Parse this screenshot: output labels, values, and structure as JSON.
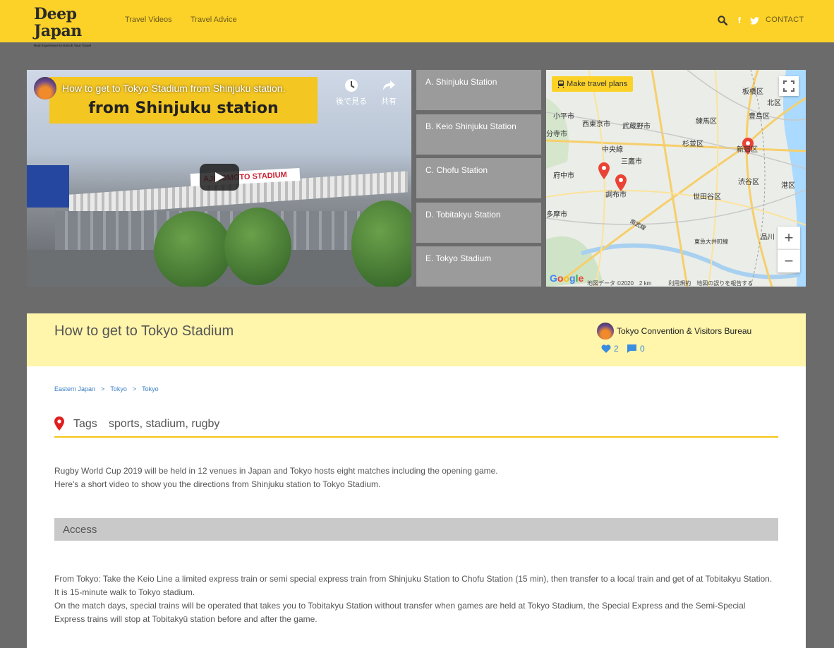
{
  "header": {
    "logo_text": "Deep Japan",
    "logo_tagline": "Real Experience to Enrich Your Travel",
    "nav": [
      "Travel Videos",
      "Travel Advice"
    ],
    "contact_label": "CONTACT",
    "icons": [
      "search-icon",
      "facebook-icon",
      "twitter-icon"
    ],
    "bg_color": "#fcd228"
  },
  "video": {
    "title": "How to get to Tokyo Stadium from Shinjuku station.",
    "banner_text": "from Shinjuku station",
    "sign_text": "AJINOMOTO STADIUM",
    "watch_later_label": "後で見る",
    "share_label": "共有"
  },
  "stations": [
    "A. Shinjuku Station",
    "B. Keio Shinjuku Station",
    "C. Chofu Station",
    "D. Tobitakyu Station",
    "E. Tokyo Stadium"
  ],
  "map": {
    "button_label": "Make travel plans",
    "labels": {
      "kodaira": "小平市",
      "nishitokyo": "西東京市",
      "musashino": "武蔵野市",
      "itabashi": "板橋区",
      "kita": "北区",
      "nerima": "練馬区",
      "toshima": "豊島区",
      "kokubunji": "分寺市",
      "chuo_line": "中央線",
      "suginami": "杉並区",
      "shinjuku": "新宿区",
      "mitaka": "三鷹市",
      "fuchu": "府中市",
      "chofu": "調布市",
      "shibuya": "渋谷区",
      "minato": "港区",
      "setagaya": "世田谷区",
      "tama": "多摩市",
      "nambu": "南武線",
      "toyoko": "東急大井町線",
      "shinagawa": "品川"
    },
    "footer": "地図データ ©2020　2 km　　　利用規約　地図の誤りを報告する",
    "google_letters": [
      "G",
      "o",
      "o",
      "g",
      "l",
      "e"
    ]
  },
  "article": {
    "title": "How to get to Tokyo Stadium",
    "author": "Tokyo Convention & Visitors Bureau",
    "likes": "2",
    "comments": "0",
    "breadcrumb": [
      "Eastern Japan",
      "Tokyo",
      "Tokyo"
    ],
    "breadcrumb_sep": ">",
    "tags_label": "Tags",
    "tags": "sports, stadium, rugby",
    "intro": [
      "Rugby World Cup 2019 will be held in 12 venues in Japan and Tokyo hosts eight matches including the opening game.",
      "Here's a short video to show you the directions from Shinjuku station to Tokyo Stadium."
    ],
    "access_heading": "Access",
    "access": [
      "From Tokyo: Take the Keio Line a limited express train or semi special express train from Shinjuku Station to Chofu Station (15 min), then transfer to a local train and get of at Tobitakyu Station.",
      "It is 15-minute walk to Tokyo stadium.",
      "On the match days, special trains will be operated that takes you to Tobitakyu Station without transfer when games are held at Tokyo Stadium, the Special Express and the Semi-Special Express trains will stop at Tobitakyū station before and after the game."
    ]
  }
}
